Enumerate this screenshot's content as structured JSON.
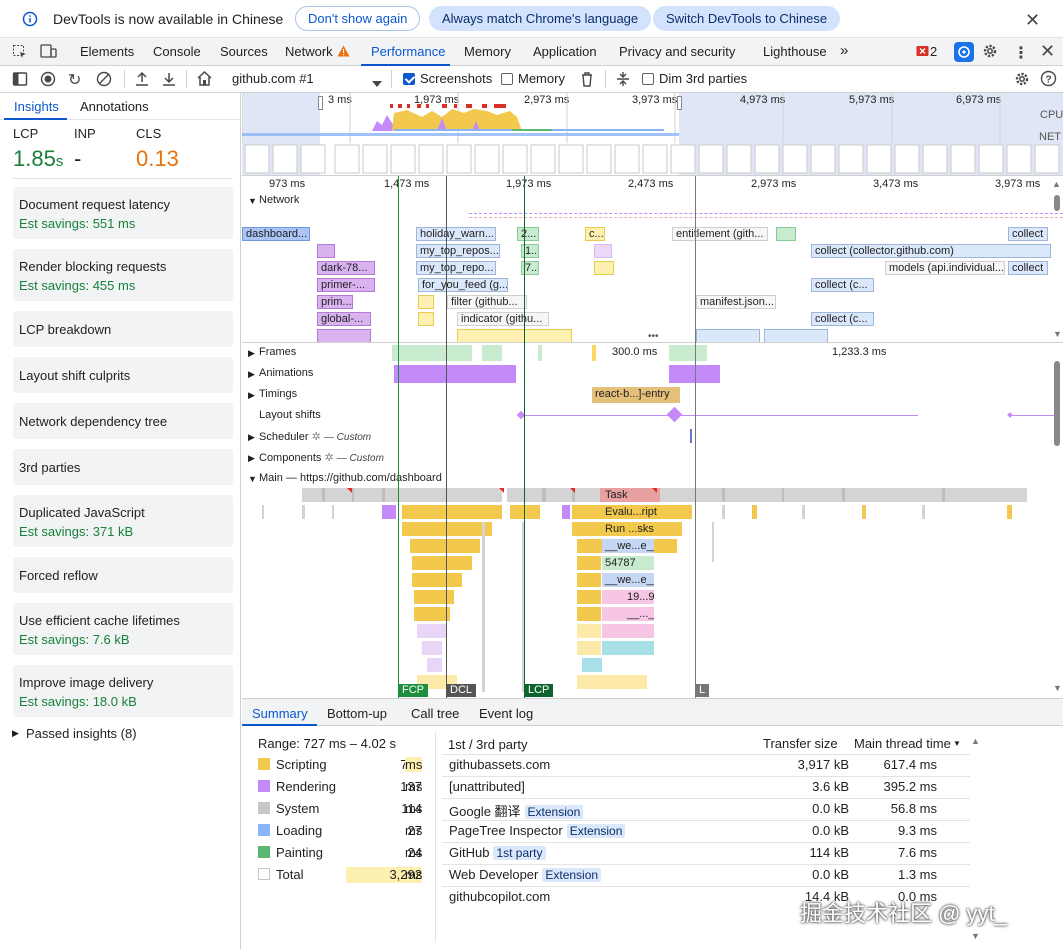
{
  "infobar": {
    "message": "DevTools is now available in Chinese",
    "dont_show": "Don't show again",
    "match_language": "Always match Chrome's language",
    "switch_chinese": "Switch DevTools to Chinese"
  },
  "tabs": [
    "Elements",
    "Console",
    "Sources",
    "Network",
    "Performance",
    "Memory",
    "Application",
    "Privacy and security",
    "Lighthouse"
  ],
  "active_tab": "Performance",
  "error_count": "2",
  "toolbar": {
    "recording": "github.com #1",
    "screenshots": "Screenshots",
    "memory": "Memory",
    "dim_3rd": "Dim 3rd parties"
  },
  "sidebar": {
    "tab_insights": "Insights",
    "tab_annotations": "Annotations",
    "metrics": {
      "lcp_label": "LCP",
      "lcp_value": "1.85",
      "lcp_unit": "s",
      "inp_label": "INP",
      "inp_value": "-",
      "cls_label": "CLS",
      "cls_value": "0.13"
    },
    "insights": [
      {
        "title": "Document request latency",
        "savings": "Est savings: 551 ms"
      },
      {
        "title": "Render blocking requests",
        "savings": "Est savings: 455 ms"
      },
      {
        "title": "LCP breakdown",
        "savings": ""
      },
      {
        "title": "Layout shift culprits",
        "savings": ""
      },
      {
        "title": "Network dependency tree",
        "savings": ""
      },
      {
        "title": "3rd parties",
        "savings": ""
      },
      {
        "title": "Duplicated JavaScript",
        "savings": "Est savings: 371 kB"
      },
      {
        "title": "Forced reflow",
        "savings": ""
      },
      {
        "title": "Use efficient cache lifetimes",
        "savings": "Est savings: 7.6 kB"
      },
      {
        "title": "Improve image delivery",
        "savings": "Est savings: 18.0 kB"
      }
    ],
    "passed": "Passed insights (8)"
  },
  "overview": {
    "labels": [
      "3 ms",
      "1,973 ms",
      "2,973 ms",
      "3,973 ms",
      "4,973 ms",
      "5,973 ms",
      "6,973 ms"
    ],
    "cpu": "CPU",
    "net": "NET"
  },
  "ruler": [
    "973 ms",
    "1,473 ms",
    "1,973 ms",
    "2,473 ms",
    "2,973 ms",
    "3,473 ms",
    "3,973 ms"
  ],
  "network": {
    "title": "Network",
    "requests": [
      "dashboard...",
      "holiday_warn...",
      "2...",
      "c...",
      "entitlement (gith...",
      "collect",
      "my_top_repos...",
      "1...",
      "collect (collector.github.com)",
      "dark-78...",
      "my_top_repo...",
      "7...",
      "models (api.individual...",
      "collect",
      "primer-...",
      "for_you_feed (g...",
      "collect (c...",
      "prim...",
      "filter (github...",
      "manifest.json...",
      "global-...",
      "indicator (githu...",
      "collect (c..."
    ]
  },
  "tracks": {
    "frames": "Frames",
    "frames_t1": "300.0 ms",
    "frames_t2": "1,233.3 ms",
    "animations": "Animations",
    "timings": "Timings",
    "timing_label": "react-b...]-entry",
    "layout_shifts": "Layout shifts",
    "scheduler": "Scheduler",
    "components": "Components",
    "custom": "— Custom",
    "main": "Main — https://github.com/dashboard",
    "flame": [
      "Task",
      "Evalu...ript",
      "Run ...sks",
      "__we...e__",
      "54787",
      "__we...e__",
      "19...9",
      "__..._"
    ]
  },
  "markers": {
    "fcp": "FCP",
    "dcl": "DCL",
    "lcp": "LCP",
    "l": "L"
  },
  "bottom_tabs": [
    "Summary",
    "Bottom-up",
    "Call tree",
    "Event log"
  ],
  "summary": {
    "range": "Range: 727 ms – 4.02 s",
    "unit": "ms",
    "categories": [
      {
        "name": "Scripting",
        "value": "786",
        "color": "#f2c94c"
      },
      {
        "name": "Rendering",
        "value": "137",
        "color": "#c58af9"
      },
      {
        "name": "System",
        "value": "114",
        "color": "#c6c6c6"
      },
      {
        "name": "Loading",
        "value": "27",
        "color": "#8ab4f8"
      },
      {
        "name": "Painting",
        "value": "24",
        "color": "#5bb974"
      },
      {
        "name": "Total",
        "value": "3,292",
        "color": "#ffffff"
      }
    ]
  },
  "thirdparty": {
    "col_party": "1st / 3rd party",
    "col_transfer": "Transfer size",
    "col_main": "Main thread time",
    "rows": [
      {
        "name": "githubassets.com",
        "badge": "",
        "transfer": "3,917 kB",
        "main": "617.4 ms"
      },
      {
        "name": "[unattributed]",
        "badge": "",
        "transfer": "3.6 kB",
        "main": "395.2 ms"
      },
      {
        "name": "Google 翻译",
        "badge": "Extension",
        "transfer": "0.0 kB",
        "main": "56.8 ms"
      },
      {
        "name": "PageTree Inspector",
        "badge": "Extension",
        "transfer": "0.0 kB",
        "main": "9.3 ms"
      },
      {
        "name": "GitHub",
        "badge": "1st party",
        "transfer": "114 kB",
        "main": "7.6 ms"
      },
      {
        "name": "Web Developer",
        "badge": "Extension",
        "transfer": "0.0 kB",
        "main": "1.3 ms"
      },
      {
        "name": "githubcopilot.com",
        "badge": "",
        "transfer": "14.4 kB",
        "main": "0.0 ms"
      }
    ]
  },
  "watermark": "掘金技术社区 @ yyt_"
}
